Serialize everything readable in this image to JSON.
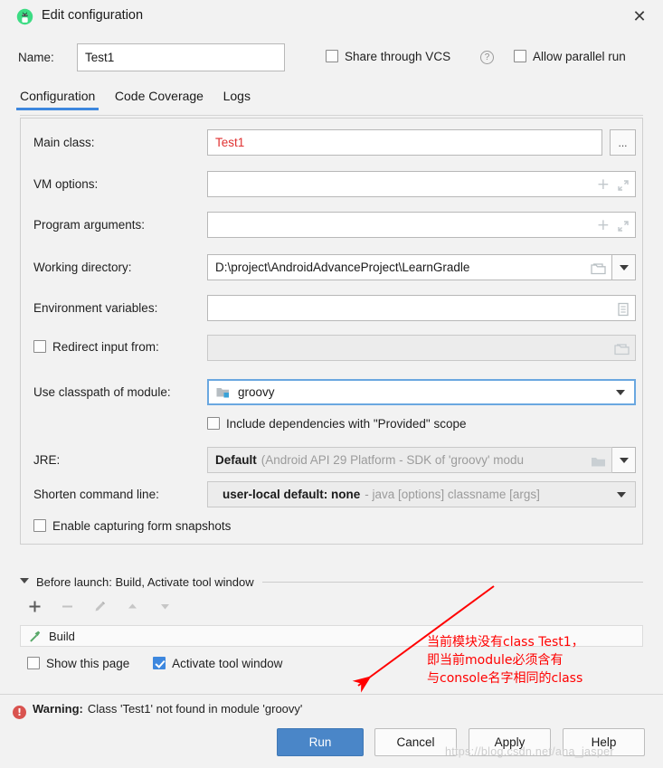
{
  "window": {
    "title": "Edit configuration",
    "app_icon": "android-robot-icon",
    "close_label": "✕"
  },
  "name_row": {
    "label": "Name:",
    "value": "Test1",
    "share_vcs_label": "Share through VCS",
    "share_vcs_checked": false,
    "help_glyph": "?",
    "allow_parallel_label": "Allow parallel run",
    "allow_parallel_checked": false
  },
  "tabs": [
    {
      "label": "Configuration",
      "active": true
    },
    {
      "label": "Code Coverage",
      "active": false
    },
    {
      "label": "Logs",
      "active": false
    }
  ],
  "form": {
    "main_class": {
      "label": "Main class:",
      "value": "Test1",
      "browse_label": "..."
    },
    "vm_options": {
      "label": "VM options:",
      "value": "",
      "icons": [
        "plus-icon",
        "expand-icon"
      ]
    },
    "program_arguments": {
      "label": "Program arguments:",
      "value": "",
      "icons": [
        "plus-icon",
        "expand-icon"
      ]
    },
    "working_directory": {
      "label": "Working directory:",
      "value": "D:\\project\\AndroidAdvanceProject\\LearnGradle",
      "icons": [
        "folder-icon",
        "chevron-down-icon"
      ]
    },
    "environment_variables": {
      "label": "Environment variables:",
      "value": "",
      "icons": [
        "document-list-icon"
      ]
    },
    "redirect_input": {
      "label": "Redirect input from:",
      "checked": false,
      "value": "",
      "icons": [
        "folder-icon"
      ]
    },
    "use_classpath": {
      "label": "Use classpath of module:",
      "value": "groovy",
      "module_icon": "module-folder-icon",
      "focused": true
    },
    "include_provided": {
      "label": "Include dependencies with \"Provided\" scope",
      "checked": false
    },
    "jre": {
      "label": "JRE:",
      "value": "Default",
      "hint": "(Android API 29 Platform - SDK of 'groovy' modu",
      "icons": [
        "folder-icon",
        "chevron-down-icon"
      ]
    },
    "shorten_command_line": {
      "label": "Shorten command line:",
      "value": "user-local default: none",
      "hint": "- java [options] classname [args]"
    },
    "enable_snapshots": {
      "label": "Enable capturing form snapshots",
      "checked": false
    }
  },
  "before_launch": {
    "header": "Before launch: Build, Activate tool window",
    "toolbar": [
      "add-icon",
      "remove-icon",
      "edit-pencil-icon",
      "move-up-icon",
      "move-down-icon"
    ],
    "tasks": [
      {
        "icon": "hammer-icon",
        "label": "Build"
      }
    ],
    "show_this_page": {
      "label": "Show this page",
      "checked": false
    },
    "activate_tool_window": {
      "label": "Activate tool window",
      "checked": true
    }
  },
  "warning": {
    "icon": "error-circle-icon",
    "prefix": "Warning:",
    "message": "Class 'Test1' not found in module 'groovy'"
  },
  "footer": {
    "run": "Run",
    "cancel": "Cancel",
    "apply": "Apply",
    "help": "Help"
  },
  "annotation": {
    "line1": "当前模块没有class Test1，",
    "line2": "即当前module必须含有",
    "line3": "与console名字相同的class",
    "color": "#ff0000"
  },
  "watermark": "https://blog.csdn.net/ana_jasper",
  "colors": {
    "accent": "#3d87de",
    "run_button": "#4a86c8",
    "error_red": "#e03131",
    "warning_icon": "#d9534f",
    "annotation_red": "#ff0000",
    "dialog_bg": "#f2f2f2"
  }
}
